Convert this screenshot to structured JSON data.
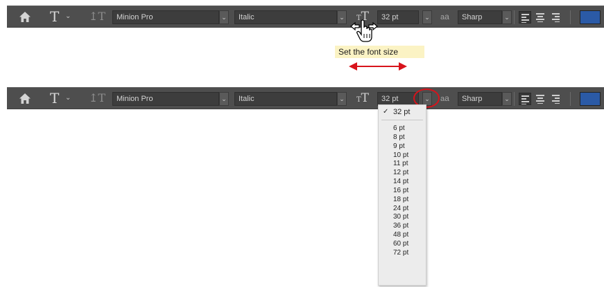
{
  "toolbar": {
    "font_family": "Minion Pro",
    "font_style": "Italic",
    "font_size": "32 pt",
    "antialias": "Sharp",
    "aa_icon_small": "a",
    "aa_icon_big": "a",
    "tool_glyph": "T",
    "color": "#2b5aa6"
  },
  "tooltip": {
    "text": "Set the font size"
  },
  "size_menu": {
    "selected": "32 pt",
    "check": "✓",
    "items": [
      "6 pt",
      "8 pt",
      "9 pt",
      "10 pt",
      "11 pt",
      "12 pt",
      "14 pt",
      "16 pt",
      "18 pt",
      "24 pt",
      "30 pt",
      "36 pt",
      "48 pt",
      "60 pt",
      "72 pt"
    ]
  },
  "annotations": {
    "arrow_color": "#d8131b",
    "highlight_color": "#d8131b"
  }
}
